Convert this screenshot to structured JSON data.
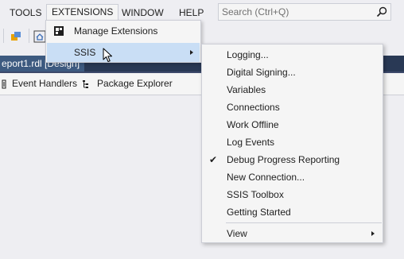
{
  "menubar": {
    "items": [
      "TOOLS",
      "EXTENSIONS",
      "WINDOW",
      "HELP"
    ],
    "search_placeholder": "Search (Ctrl+Q)"
  },
  "document": {
    "tab_title": "eport1.rdl [Design]"
  },
  "designer_tabs": [
    "Event Handlers",
    "Package Explorer"
  ],
  "extensions_menu": {
    "items": [
      {
        "label": "Manage Extensions",
        "has_submenu": false
      },
      {
        "label": "SSIS",
        "has_submenu": true,
        "highlighted": true
      }
    ]
  },
  "ssis_menu": {
    "items": [
      {
        "label": "Logging...",
        "checked": false
      },
      {
        "label": "Digital Signing...",
        "checked": false
      },
      {
        "label": "Variables",
        "checked": false
      },
      {
        "label": "Connections",
        "checked": false
      },
      {
        "label": "Work Offline",
        "checked": false
      },
      {
        "label": "Log Events",
        "checked": false
      },
      {
        "label": "Debug Progress Reporting",
        "checked": true
      },
      {
        "label": "New Connection...",
        "checked": false
      },
      {
        "label": "SSIS Toolbox",
        "checked": false
      },
      {
        "label": "Getting Started",
        "checked": false
      },
      {
        "label": "View",
        "checked": false,
        "has_submenu": true
      }
    ],
    "check_glyph": "✔"
  },
  "colors": {
    "menu_bg": "#f5f5f5",
    "highlight": "#c9def5",
    "doc_tab_bg": "#3d5a80",
    "doc_strip_bg": "#293955"
  }
}
